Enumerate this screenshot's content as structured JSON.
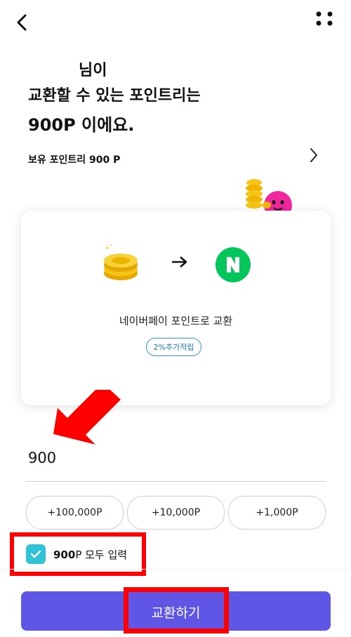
{
  "header": {
    "back_icon": "chevron-left-icon",
    "more_icon": "dots-grid-icon"
  },
  "title": {
    "line1": "님이",
    "line2": "교환할 수 있는 포인트리는",
    "line3": "900P 이에요."
  },
  "owned_points": {
    "label": "보유 포인트리 900 P"
  },
  "exchange_card": {
    "title": "네이버페이 포인트로 교환",
    "badge": "2%추가적립",
    "naver_letter": "N"
  },
  "amount": {
    "value": "900"
  },
  "quick_add": [
    {
      "label": "+100,000P"
    },
    {
      "label": "+10,000P"
    },
    {
      "label": "+1,000P"
    }
  ],
  "all_input": {
    "bold_part": "900",
    "rest": "P 모두 입력",
    "checked": true
  },
  "submit": {
    "label": "교환하기"
  },
  "colors": {
    "accent": "#5f56e6",
    "checkbox": "#2ec3d6",
    "naver_green": "#03c75a",
    "annotation_red": "#ff0000"
  }
}
